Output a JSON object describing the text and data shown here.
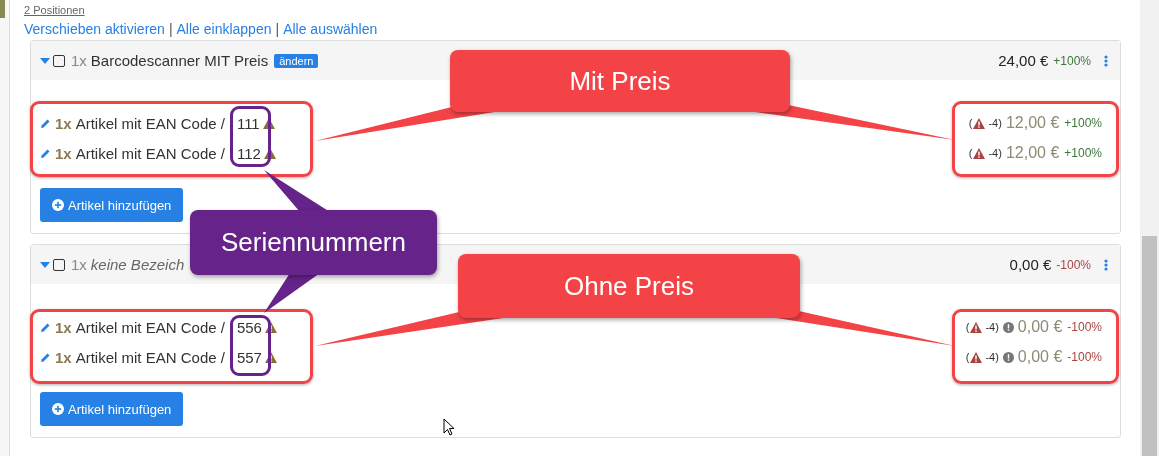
{
  "positions_count": "2 Positionen",
  "links": [
    {
      "kind": "link",
      "text": "Verschieben aktivieren"
    },
    {
      "kind": "separator",
      "text": "|"
    },
    {
      "kind": "link",
      "text": "Alle einklappen"
    },
    {
      "kind": "separator",
      "text": "|"
    },
    {
      "kind": "link",
      "text": "Alle auswählen"
    }
  ],
  "groups": [
    {
      "expanded": true,
      "checked": false,
      "qty": "1x",
      "name": "Barcodescanner MIT Preis",
      "italic": false,
      "badge": "ändern",
      "price": "24,00 €",
      "percent": "+100%",
      "color": "#3c763d",
      "add_button": "Artikel hinzufügen",
      "items": [
        {
          "qty": "1x",
          "name": "Artikel mit EAN Code /",
          "serial": "111",
          "stock_prefix": "(",
          "stock": "-4)",
          "info": false,
          "price": "12,00 €",
          "percent": "+100%",
          "color": "#3c763d"
        },
        {
          "qty": "1x",
          "name": "Artikel mit EAN Code /",
          "serial": "112",
          "stock_prefix": "(",
          "stock": "-4)",
          "info": false,
          "price": "12,00 €",
          "percent": "+100%",
          "color": "#3c763d"
        }
      ]
    },
    {
      "expanded": true,
      "checked": false,
      "qty": "1x",
      "name": "keine Bezeich",
      "italic": true,
      "price": "0,00 €",
      "percent": "-100%",
      "color": "#a94442",
      "add_button": "Artikel hinzufügen",
      "items": [
        {
          "qty": "1x",
          "name": "Artikel mit EAN Code /",
          "serial": "556",
          "stock_prefix": "(",
          "stock": "-4)",
          "info": true,
          "price": "0,00 €",
          "percent": "-100%",
          "color": "#a94442"
        },
        {
          "qty": "1x",
          "name": "Artikel mit EAN Code /",
          "serial": "557",
          "stock_prefix": "(",
          "stock": "-4)",
          "info": true,
          "price": "0,00 €",
          "percent": "-100%",
          "color": "#a94442"
        }
      ]
    }
  ],
  "annotations": [
    {
      "kind": "red",
      "text": "Mit Preis"
    },
    {
      "kind": "purple",
      "text": "Seriennummern"
    },
    {
      "kind": "red",
      "text": "Ohne Preis"
    }
  ]
}
